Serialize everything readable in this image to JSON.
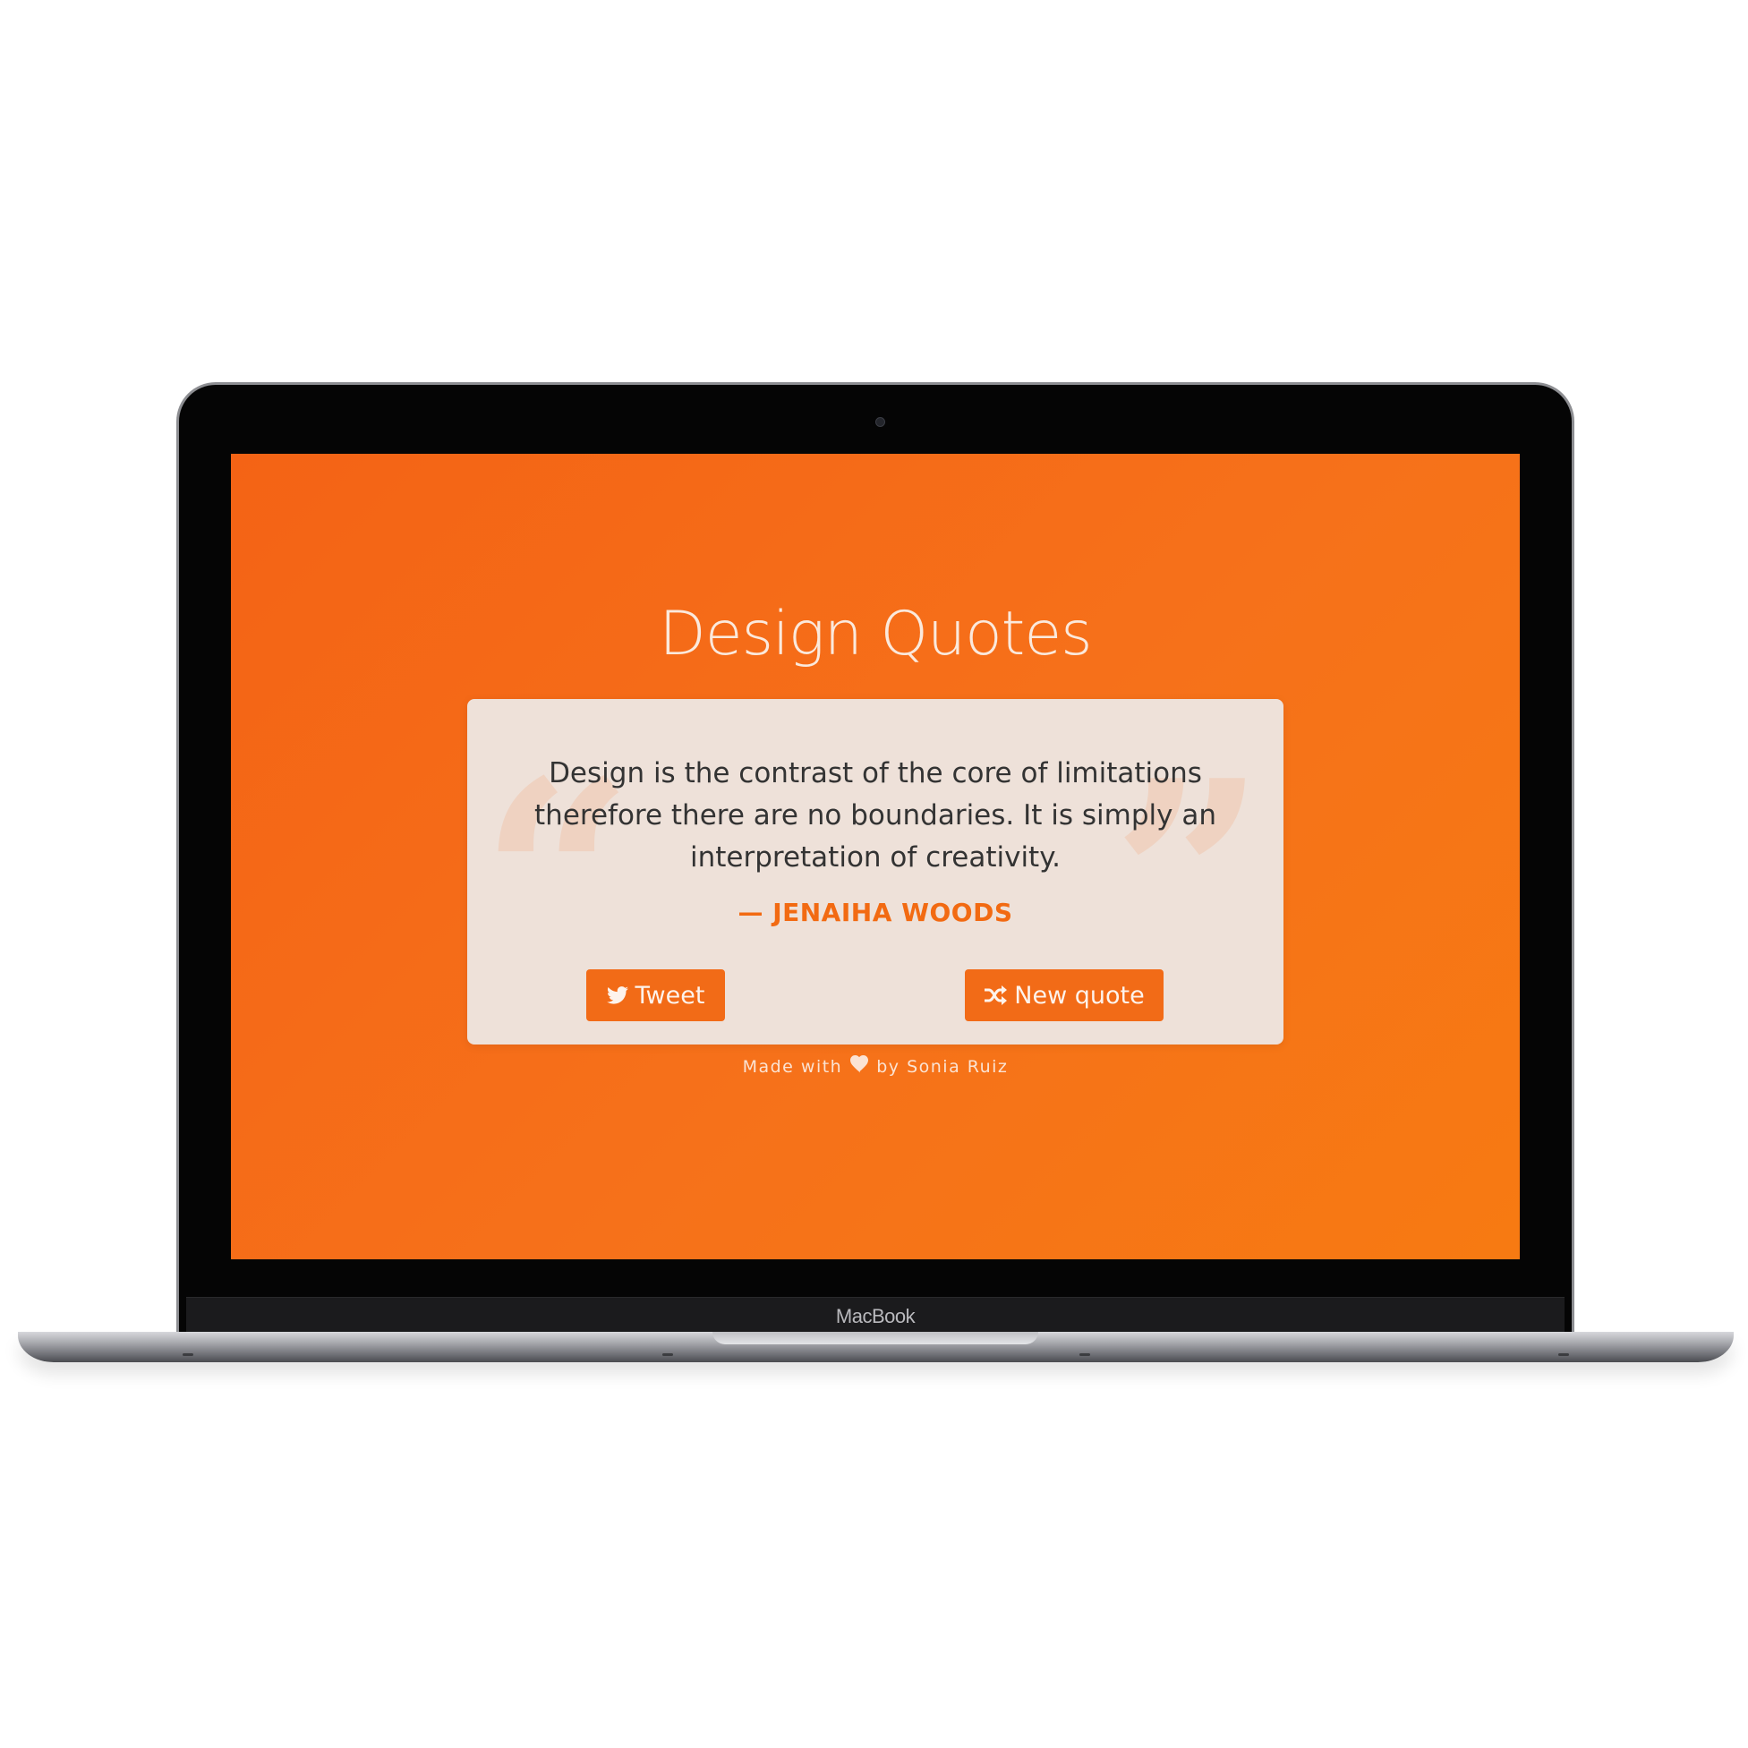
{
  "device": {
    "brand_label": "MacBook"
  },
  "app": {
    "title": "Design Quotes",
    "accent_color": "#f26b17",
    "background_colors": [
      "#f46315",
      "#f77a12"
    ]
  },
  "quote": {
    "open_mark": "“",
    "close_mark": "”",
    "text": "Design is the contrast of the core of limitations therefore there are no boundaries. It is simply an interpretation of creativity.",
    "author": "— JENAIHA WOODS"
  },
  "actions": {
    "tweet_label": "Tweet",
    "tweet_icon": "twitter-icon",
    "new_quote_label": "New quote",
    "new_quote_icon": "shuffle-icon"
  },
  "footer": {
    "prefix": "Made with",
    "icon": "heart-icon",
    "suffix": "by Sonia Ruiz"
  }
}
